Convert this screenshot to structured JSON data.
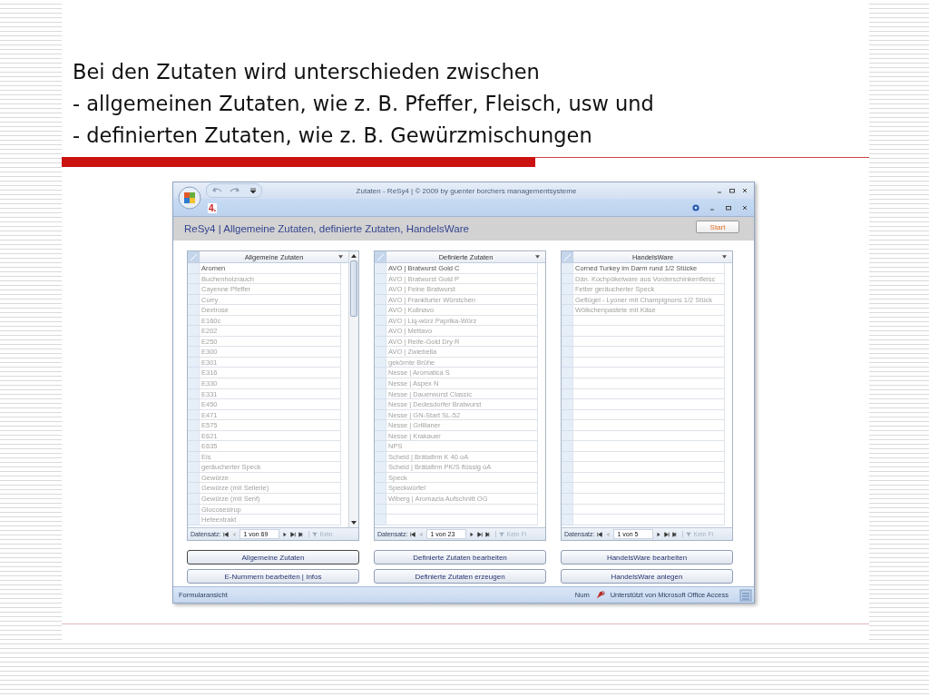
{
  "slide": {
    "title_lines": [
      "Bei den Zutaten wird unterschieden zwischen",
      "- allgemeinen Zutaten, wie z. B. Pfeffer, Fleisch, usw und",
      "- definierten Zutaten, wie z. B. Gewürzmischungen"
    ]
  },
  "window": {
    "title": "Zutaten - ReSy4 | © 2009 by guenter borchers managementsysteme",
    "quick_access_label": "4.",
    "header_title": "ReSy4 | Allgemeine Zutaten, definierte Zutaten, HandelsWare",
    "start_button": "Start"
  },
  "lists": [
    {
      "header": "Allgemeine Zutaten",
      "scrollbar": true,
      "record_label": "Datensatz:",
      "record_position": "1 von 69",
      "filter_label": "Kein",
      "rows": [
        {
          "text": "Aromen",
          "selected": true
        },
        {
          "text": "Buchenholzrauch",
          "selected": false
        },
        {
          "text": "Cayenne Pfeffer",
          "selected": false
        },
        {
          "text": "Curry",
          "selected": false
        },
        {
          "text": "Dextrose",
          "selected": false
        },
        {
          "text": "E160c",
          "selected": false
        },
        {
          "text": "E202",
          "selected": false
        },
        {
          "text": "E250",
          "selected": false
        },
        {
          "text": "E300",
          "selected": false
        },
        {
          "text": "E301",
          "selected": false
        },
        {
          "text": "E316",
          "selected": false
        },
        {
          "text": "E330",
          "selected": false
        },
        {
          "text": "E331",
          "selected": false
        },
        {
          "text": "E450",
          "selected": false
        },
        {
          "text": "E471",
          "selected": false
        },
        {
          "text": "E575",
          "selected": false
        },
        {
          "text": "E621",
          "selected": false
        },
        {
          "text": "E635",
          "selected": false
        },
        {
          "text": "Eis",
          "selected": false
        },
        {
          "text": "geräucherter Speck",
          "selected": false
        },
        {
          "text": "Gewürze",
          "selected": false
        },
        {
          "text": "Gewürze (mit Sellerie)",
          "selected": false
        },
        {
          "text": "Gewürze (mit Senf)",
          "selected": false
        },
        {
          "text": "Glucosesirup",
          "selected": false
        },
        {
          "text": "Hefeextrakt",
          "selected": false
        }
      ],
      "buttons": [
        {
          "label": "Allgemeine Zutaten",
          "focused": true
        },
        {
          "label": "E-Nummern bearbeiten | Infos",
          "focused": false
        }
      ]
    },
    {
      "header": "Definierte Zutaten",
      "scrollbar": false,
      "record_label": "Datensatz:",
      "record_position": "1 von 23",
      "filter_label": "Kein Fi",
      "rows": [
        {
          "text": "AVO | Bratwurst Gold C",
          "selected": true
        },
        {
          "text": "AVO | Bratwurst Gold P",
          "selected": false
        },
        {
          "text": "AVO | Feine Bratwurst",
          "selected": false
        },
        {
          "text": "AVO | Frankfurter Würstchen",
          "selected": false
        },
        {
          "text": "AVO | Kulinavo",
          "selected": false
        },
        {
          "text": "AVO | Liq-würz Paprika-Würz",
          "selected": false
        },
        {
          "text": "AVO | Mettavo",
          "selected": false
        },
        {
          "text": "AVO | Reife-Gold Dry R",
          "selected": false
        },
        {
          "text": "AVO | Zwiebella",
          "selected": false
        },
        {
          "text": "gekörnte Brühe",
          "selected": false
        },
        {
          "text": "Nesse | Aromatica S",
          "selected": false
        },
        {
          "text": "Nesse | Aspex N",
          "selected": false
        },
        {
          "text": "Nesse | Dauerwurst Classic",
          "selected": false
        },
        {
          "text": "Nesse | Dedesdorfer Bratwurst",
          "selected": false
        },
        {
          "text": "Nesse | GN-Start SL-52",
          "selected": false
        },
        {
          "text": "Nesse | Grillianer",
          "selected": false
        },
        {
          "text": "Nesse | Krakauer",
          "selected": false
        },
        {
          "text": "NPS",
          "selected": false
        },
        {
          "text": "Scheid | Brätafirm K 40 oA",
          "selected": false
        },
        {
          "text": "Scheid | Brätafirm PK/S flüssig oA",
          "selected": false
        },
        {
          "text": "Speck",
          "selected": false
        },
        {
          "text": "Speckwürfel",
          "selected": false
        },
        {
          "text": "Wiberg | Aromazia Aufschnitt OG",
          "selected": false
        }
      ],
      "buttons": [
        {
          "label": "Definierte Zutaten bearbeiten",
          "focused": false
        },
        {
          "label": "Definierte Zutaten erzeugen",
          "focused": false
        }
      ]
    },
    {
      "header": "HandelsWare",
      "scrollbar": false,
      "record_label": "Datensatz:",
      "record_position": "1 von 5",
      "filter_label": "Kein Fi",
      "rows": [
        {
          "text": "Corned Turkey im Darm rund 1/2 Stücke",
          "selected": true
        },
        {
          "text": "Dän. Kochpökelware aus Vorderschinkenfleisc",
          "selected": false
        },
        {
          "text": "Fetter geräucherter Speck",
          "selected": false
        },
        {
          "text": "Geflügel - Lyoner mit Champignons 1/2 Stück",
          "selected": false
        },
        {
          "text": "Wölkchenpastete mit Käse",
          "selected": false
        }
      ],
      "buttons": [
        {
          "label": "HandelsWare bearbeiten",
          "focused": false
        },
        {
          "label": "HandelsWare anlegen",
          "focused": false
        }
      ]
    }
  ],
  "status_bar": {
    "view": "Formularansicht",
    "num": "Num",
    "product": "Unterstützt von Microsoft Office Access"
  }
}
